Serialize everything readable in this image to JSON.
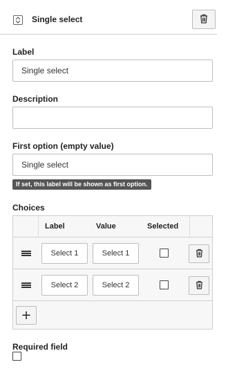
{
  "header": {
    "title": "Single select",
    "type_icon": "select-updown-icon",
    "delete_icon": "trash-icon"
  },
  "label_field": {
    "label": "Label",
    "value": "Single select"
  },
  "description_field": {
    "label": "Description",
    "value": ""
  },
  "first_option_field": {
    "label": "First option (empty value)",
    "value": "Single select",
    "hint": "If set, this label will be shown as first option."
  },
  "choices": {
    "label": "Choices",
    "columns": {
      "label": "Label",
      "value": "Value",
      "selected": "Selected"
    },
    "rows": [
      {
        "label": "Select 1",
        "value": "Select 1",
        "selected": false
      },
      {
        "label": "Select 2",
        "value": "Select 2",
        "selected": false
      }
    ],
    "add_label": "+"
  },
  "required_field": {
    "label": "Required field",
    "checked": false
  }
}
